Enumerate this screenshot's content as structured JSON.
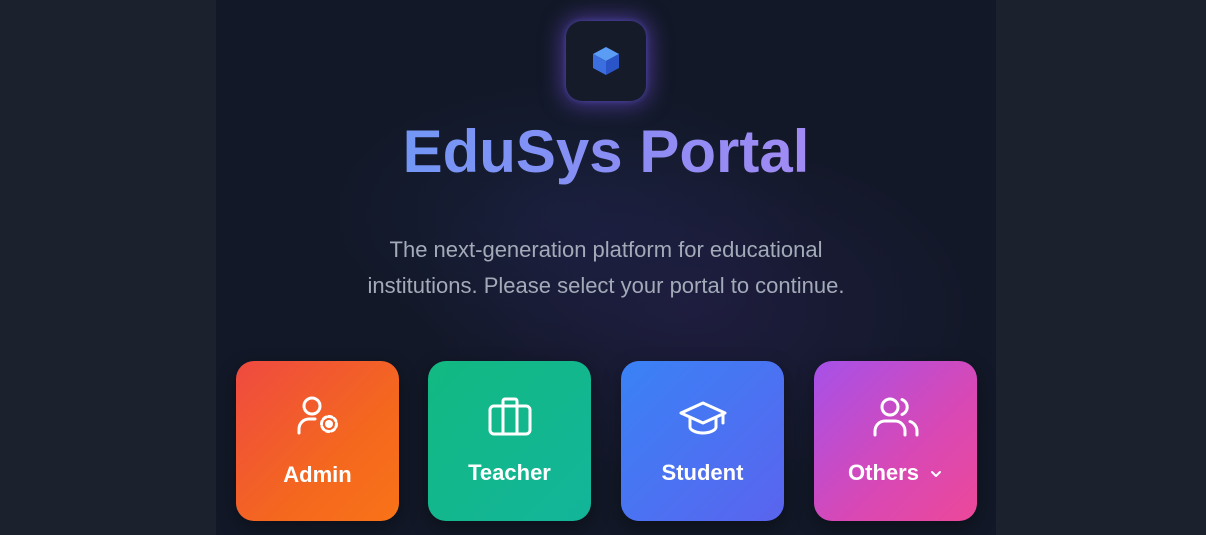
{
  "brand": {
    "title": "EduSys Portal",
    "logo_icon": "cube-icon",
    "subtitle": "The next-generation platform for educational institutions. Please select your portal to continue."
  },
  "portals": [
    {
      "label": "Admin",
      "icon": "user-gear-icon",
      "color_from": "#ef4a41",
      "color_to": "#f97317"
    },
    {
      "label": "Teacher",
      "icon": "briefcase-icon",
      "color_from": "#12b981",
      "color_to": "#13b59a"
    },
    {
      "label": "Student",
      "icon": "graduation-cap-icon",
      "color_from": "#3a82f6",
      "color_to": "#5a64ee"
    },
    {
      "label": "Others",
      "icon": "users-icon",
      "dropdown_icon": "chevron-down-icon",
      "color_from": "#a651e9",
      "color_to": "#ec4899"
    }
  ],
  "colors": {
    "background": "#1c222d",
    "panel": "#121827",
    "title_gradient_start": "#5fa0f7",
    "title_gradient_end": "#b889f5",
    "subtitle_text": "#a3aab8"
  }
}
